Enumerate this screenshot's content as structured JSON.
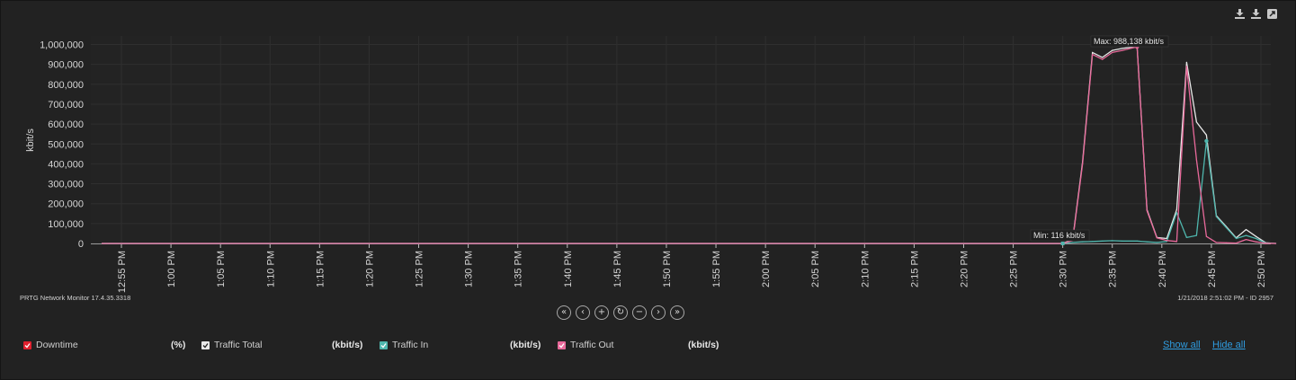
{
  "toolbar": {
    "icons": [
      "download-icon",
      "download-icon",
      "expand-icon"
    ]
  },
  "footer": {
    "version": "PRTG Network Monitor 17.4.35.3318",
    "timestamp": "1/21/2018 2:51:02 PM - ID 2957"
  },
  "nav": {
    "buttons": [
      {
        "name": "first-page",
        "glyph": "«"
      },
      {
        "name": "previous",
        "glyph": "‹"
      },
      {
        "name": "zoom-in",
        "glyph": "+"
      },
      {
        "name": "reset",
        "glyph": "↻"
      },
      {
        "name": "zoom-out",
        "glyph": "−"
      },
      {
        "name": "next",
        "glyph": "›"
      },
      {
        "name": "last-page",
        "glyph": "»"
      }
    ]
  },
  "legend": {
    "items": [
      {
        "label": "Downtime",
        "unit": "(%)",
        "color": "#e0202e"
      },
      {
        "label": "Traffic Total",
        "unit": "(kbit/s)",
        "color": "#e8e8e8"
      },
      {
        "label": "Traffic In",
        "unit": "(kbit/s)",
        "color": "#4fb6ad"
      },
      {
        "label": "Traffic Out",
        "unit": "(kbit/s)",
        "color": "#e8699a"
      }
    ],
    "show_all": "Show all",
    "hide_all": "Hide all"
  },
  "chart_data": {
    "type": "line",
    "ylabel": "kbit/s",
    "ylim": [
      0,
      1000000
    ],
    "y_ticks": [
      "0",
      "100,000",
      "200,000",
      "300,000",
      "400,000",
      "500,000",
      "600,000",
      "700,000",
      "800,000",
      "900,000",
      "1,000,000"
    ],
    "x_ticks": [
      "12:55 PM",
      "1:00 PM",
      "1:05 PM",
      "1:10 PM",
      "1:15 PM",
      "1:20 PM",
      "1:25 PM",
      "1:30 PM",
      "1:35 PM",
      "1:40 PM",
      "1:45 PM",
      "1:50 PM",
      "1:55 PM",
      "2:00 PM",
      "2:05 PM",
      "2:10 PM",
      "2:15 PM",
      "2:20 PM",
      "2:25 PM",
      "2:30 PM",
      "2:35 PM",
      "2:40 PM",
      "2:45 PM",
      "2:50 PM"
    ],
    "x_range_minutes": [
      773,
      892
    ],
    "grid": true,
    "annotations": [
      {
        "text": "Max: 988,138 kbit/s",
        "x": 877.5,
        "y": 988138
      },
      {
        "text": "Min: 116 kbit/s",
        "x": 870,
        "y": 116
      }
    ],
    "series": [
      {
        "name": "Traffic Total",
        "color": "#e8e8e8",
        "x": [
          870,
          871,
          872,
          873,
          874,
          875,
          876,
          877.5,
          878.5,
          879.5,
          880.5,
          881.5,
          882.5,
          883.5,
          884.5,
          885.5,
          886.5,
          887.5,
          888.5,
          889.5,
          890.5,
          891.5
        ],
        "values": [
          0,
          20000,
          410000,
          960000,
          935000,
          970000,
          980000,
          990000,
          170000,
          30000,
          25000,
          170000,
          910000,
          610000,
          545000,
          140000,
          85000,
          28000,
          70000,
          35000,
          3000,
          0
        ]
      },
      {
        "name": "Traffic In",
        "color": "#4fb6ad",
        "x": [
          870,
          871,
          872,
          873,
          874,
          875,
          876,
          877.5,
          878.5,
          879.5,
          880.5,
          881.5,
          882.5,
          883.5,
          884.5,
          885.5,
          886.5,
          887.5,
          888.5,
          889.5,
          890.5,
          891.5
        ],
        "values": [
          116,
          5000,
          8000,
          10000,
          12000,
          14000,
          12000,
          12000,
          8000,
          5000,
          10000,
          155000,
          30000,
          40000,
          515000,
          135000,
          80000,
          25000,
          40000,
          25000,
          2000,
          0
        ]
      },
      {
        "name": "Traffic Out",
        "color": "#e8699a",
        "x": [
          870,
          871,
          872,
          873,
          874,
          875,
          876,
          877.5,
          878.5,
          879.5,
          880.5,
          881.5,
          882.5,
          883.5,
          884.5,
          885.5,
          886.5,
          887.5,
          888.5,
          889.5,
          890.5,
          891.5
        ],
        "values": [
          0,
          15000,
          400000,
          950000,
          925000,
          960000,
          970000,
          988138,
          165000,
          28000,
          15000,
          10000,
          890000,
          420000,
          35000,
          5000,
          3000,
          2000,
          20000,
          8000,
          1000,
          0
        ]
      }
    ]
  }
}
